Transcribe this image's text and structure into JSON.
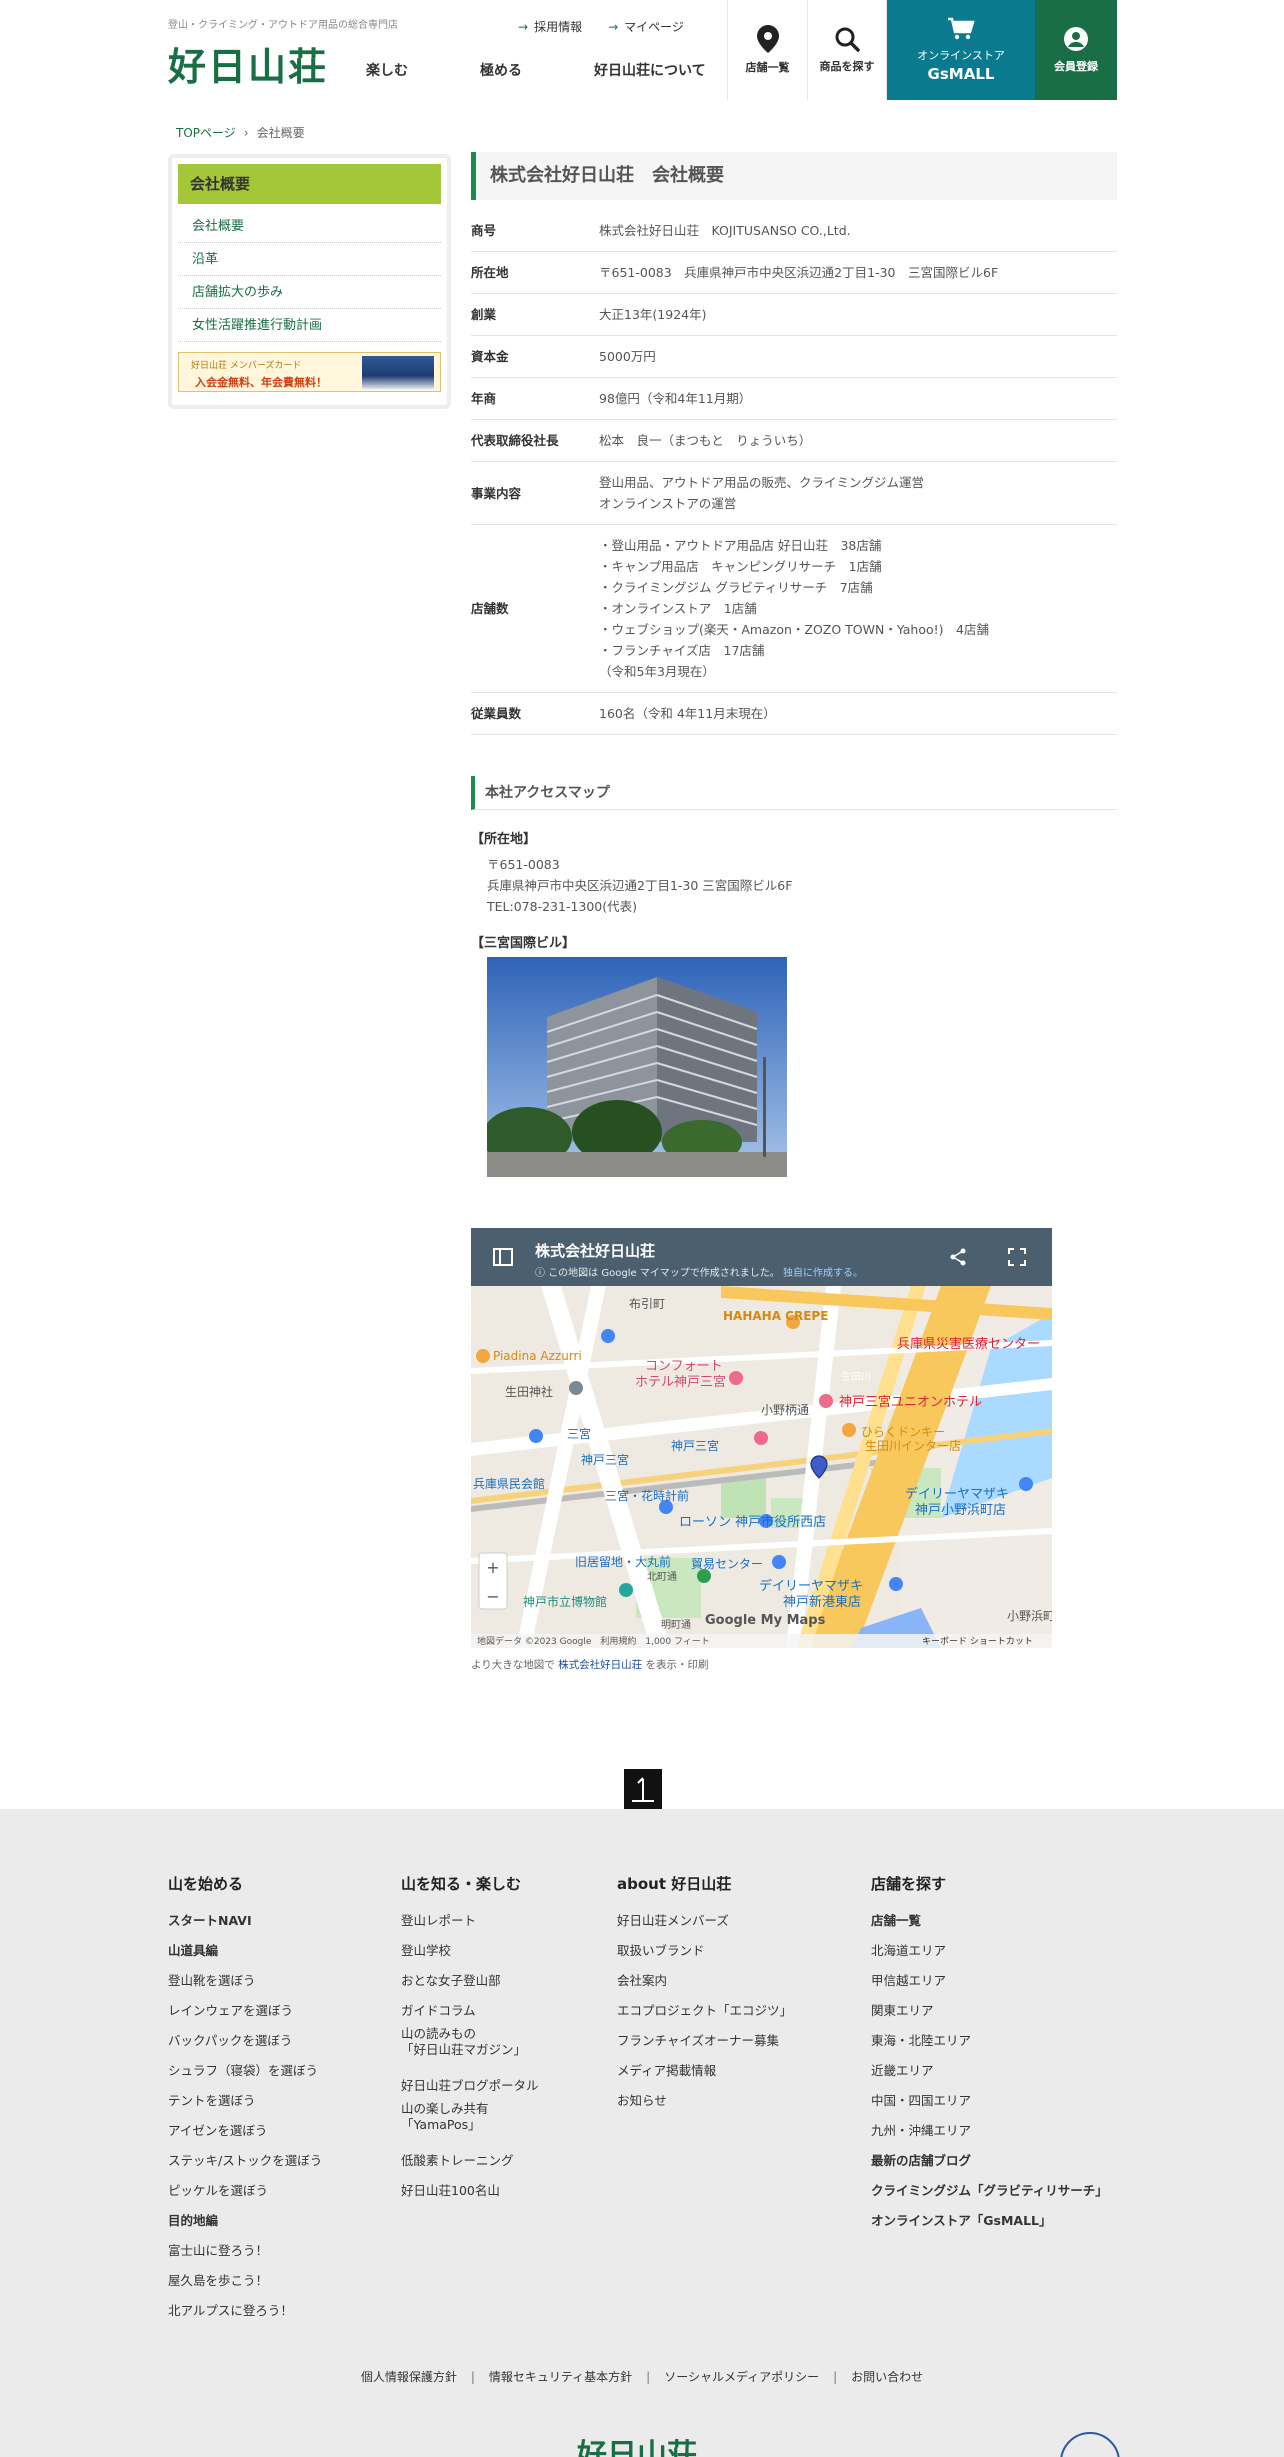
{
  "header": {
    "tagline": "登山・クライミング・アウトドア用品の総合専門店",
    "logo": "好日山荘",
    "toplinks": [
      "採用情報",
      "マイページ"
    ],
    "nav": [
      "楽しむ",
      "極める",
      "好日山荘について"
    ],
    "stores_label": "店舗一覧",
    "search_label": "商品を探す",
    "online_label_1": "オンラインストア",
    "online_label_2": "GsMALL",
    "member_label": "会員登録",
    "colors": {
      "brand_green": "#1a6e45",
      "online_blue": "#0a7a8f"
    }
  },
  "breadcrumb": {
    "home": "TOPページ",
    "current": "会社概要"
  },
  "sidebar": {
    "title": "会社概要",
    "items": [
      "会社概要",
      "沿革",
      "店舗拡大の歩み",
      "女性活躍推進行動計画"
    ],
    "banner_1": "好日山荘 メンバーズカード",
    "banner_2": "入会金無料、年会費無料！"
  },
  "main": {
    "title": "株式会社好日山荘　会社概要",
    "rows": [
      {
        "key": "商号",
        "lines": [
          "株式会社好日山荘　KOJITUSANSO CO.,Ltd."
        ]
      },
      {
        "key": "所在地",
        "lines": [
          "〒651-0083　兵庫県神戸市中央区浜辺通2丁目1-30　三宮国際ビル6F"
        ]
      },
      {
        "key": "創業",
        "lines": [
          "大正13年(1924年)"
        ]
      },
      {
        "key": "資本金",
        "lines": [
          "5000万円"
        ]
      },
      {
        "key": "年商",
        "lines": [
          "98億円（令和4年11月期）"
        ]
      },
      {
        "key": "代表取締役社長",
        "lines": [
          "松本　良一（まつもと　りょういち）"
        ]
      },
      {
        "key": "事業内容",
        "lines": [
          "登山用品、アウトドア用品の販売、クライミングジム運営",
          "オンラインストアの運営"
        ]
      },
      {
        "key": "店舗数",
        "lines": [
          "・登山用品・アウトドア用品店 好日山荘　38店舗",
          "・キャンプ用品店　キャンピングリサーチ　1店舗",
          "・クライミングジム グラビティリサーチ　7店舗",
          "・オンラインストア　1店舗",
          "・ウェブショップ(楽天・Amazon・ZOZO TOWN・Yahoo!)　4店舗",
          "・フランチャイズ店　17店舗",
          "（令和5年3月現在）"
        ]
      },
      {
        "key": "従業員数",
        "lines": [
          "160名（令和 4年11月末現在）"
        ]
      }
    ],
    "access_title": "本社アクセスマップ",
    "addr_label": "【所在地】",
    "addr_lines": [
      "〒651-0083",
      "兵庫県神戸市中央区浜辺通2丁目1-30 三宮国際ビル6F",
      "TEL:078-231-1300(代表)"
    ],
    "building_label": "【三宮国際ビル】"
  },
  "map": {
    "title": "株式会社好日山荘",
    "notice": "この地図は Google マイマップで作成されました。",
    "notice_link": "独自に作成する。",
    "labels": [
      "布引町",
      "HAHAHA CREPE",
      "兵庫県災害医療センター",
      "Piadina Azzurri",
      "コンフォート",
      "ホテル神戸三宮",
      "生田神社",
      "生田川",
      "神戸三宮ユニオンホテル",
      "三宮",
      "神戸三宮",
      "小野柄通",
      "ひらくドンキー",
      "生田川インター店",
      "神戸三宮",
      "兵庫県民会館",
      "三宮・花時計前",
      "デイリーヤマザキ",
      "神戸小野浜町店",
      "ローソン 神戸市役所西店",
      "旧居留地・大丸前",
      "貿易センター",
      "デイリーヤマザキ",
      "神戸新港東店",
      "神戸市立博物館",
      "北町通",
      "小野浜町",
      "明町通"
    ],
    "footer_left": "地図データ ©2023 Google　利用規約　1,000 フィート",
    "footer_right": "キーボード ショートカット",
    "logo": "Google My Maps",
    "zoom_in": "+",
    "zoom_out": "−",
    "caption_pre": "より大きな地図で",
    "caption_link": "株式会社好日山荘",
    "caption_post": "を表示・印刷"
  },
  "footer": {
    "columns": [
      {
        "heading": "山を始める",
        "items": [
          {
            "t": "スタートNAVI",
            "b": true
          },
          {
            "t": "山道具編",
            "b": true
          },
          {
            "t": "登山靴を選ぼう"
          },
          {
            "t": "レインウェアを選ぼう"
          },
          {
            "t": "バックパックを選ぼう"
          },
          {
            "t": "シュラフ（寝袋）を選ぼう"
          },
          {
            "t": "テントを選ぼう"
          },
          {
            "t": "アイゼンを選ぼう"
          },
          {
            "t": "ステッキ/ストックを選ぼう"
          },
          {
            "t": "ピッケルを選ぼう"
          },
          {
            "t": "目的地編",
            "b": true
          },
          {
            "t": "富士山に登ろう！"
          },
          {
            "t": "屋久島を歩こう！"
          },
          {
            "t": "北アルプスに登ろう！"
          }
        ]
      },
      {
        "heading": "山を知る・楽しむ",
        "items": [
          {
            "t": "登山レポート"
          },
          {
            "t": "登山学校"
          },
          {
            "t": "おとな女子登山部"
          },
          {
            "t": "ガイドコラム"
          },
          {
            "t": "山の読みもの",
            "t2": "「好日山荘マガジン」"
          },
          {
            "t": "好日山荘ブログポータル"
          },
          {
            "t": "山の楽しみ共有",
            "t2": "「YamaPos」"
          },
          {
            "t": "低酸素トレーニング"
          },
          {
            "t": "好日山荘100名山"
          }
        ]
      },
      {
        "heading": "about 好日山荘",
        "items": [
          {
            "t": "好日山荘メンバーズ"
          },
          {
            "t": "取扱いブランド"
          },
          {
            "t": "会社案内"
          },
          {
            "t": "エコプロジェクト「エコジツ」"
          },
          {
            "t": "フランチャイズオーナー募集"
          },
          {
            "t": "メディア掲載情報"
          },
          {
            "t": "お知らせ"
          }
        ]
      },
      {
        "heading": "店舗を探す",
        "items": [
          {
            "t": "店舗一覧",
            "b": true
          },
          {
            "t": "北海道エリア"
          },
          {
            "t": "甲信越エリア"
          },
          {
            "t": "関東エリア"
          },
          {
            "t": "東海・北陸エリア"
          },
          {
            "t": "近畿エリア"
          },
          {
            "t": "中国・四国エリア"
          },
          {
            "t": "九州・沖縄エリア"
          },
          {
            "t": "最新の店舗ブログ",
            "b": true
          },
          {
            "t": "クライミングジム「グラビティリサーチ」",
            "b": true
          },
          {
            "t": "オンラインストア「GsMALL」",
            "b": true
          }
        ]
      }
    ],
    "links": [
      "個人情報保護方針",
      "情報セキュリティ基本方針",
      "ソーシャルメディアポリシー",
      "お問い合わせ"
    ],
    "logo": "好日山荘"
  }
}
